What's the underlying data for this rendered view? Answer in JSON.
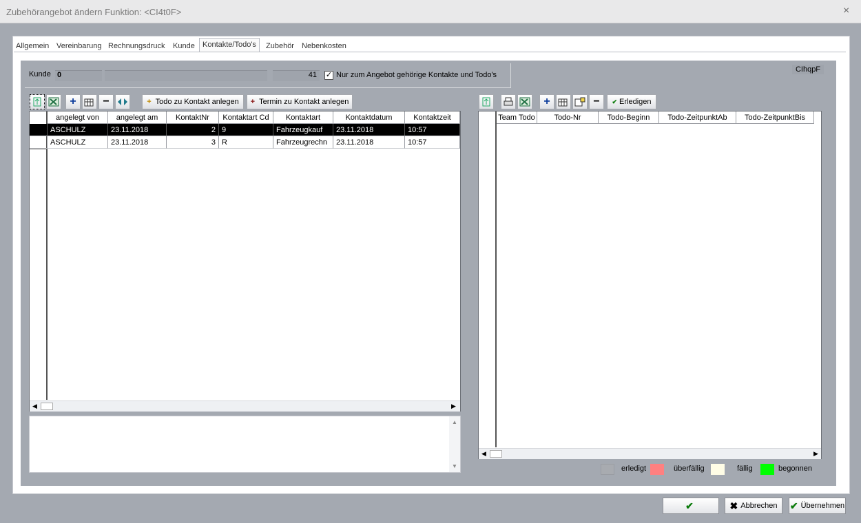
{
  "window": {
    "title": "Zubehörangebot ändern Funktion: <CI4t0F>",
    "close_glyph": "×"
  },
  "tabs": [
    {
      "label": "Allgemein"
    },
    {
      "label": "Vereinbarung"
    },
    {
      "label": "Rechnungsdruck"
    },
    {
      "label": "Kunde"
    },
    {
      "label": "Kontakte/Todo's",
      "active": true
    },
    {
      "label": "Zubehör"
    },
    {
      "label": "Nebenkosten"
    }
  ],
  "kunde": {
    "label": "Kunde",
    "number": "0",
    "count": "41",
    "checkbox_label": "Nur zum Angebot gehörige Kontakte und Todo's",
    "checked": true,
    "code": "CIhqpF"
  },
  "left_toolbar": {
    "todo_button": "Todo zu Kontakt anlegen",
    "termin_button": "Termin zu Kontakt anlegen"
  },
  "contacts": {
    "columns": [
      "angelegt von",
      "angelegt am",
      "KontaktNr",
      "Kontaktart Cd",
      "Kontaktart",
      "Kontaktdatum",
      "Kontaktzeit"
    ],
    "rows": [
      {
        "angelegt_von": "ASCHULZ",
        "angelegt_am": "23.11.2018",
        "kontaktnr": "2",
        "kontaktart_cd": "9",
        "kontaktart": "Fahrzeugkauf",
        "kontaktdatum": "23.11.2018",
        "kontaktzeit": "10:57",
        "selected": true
      },
      {
        "angelegt_von": "ASCHULZ",
        "angelegt_am": "23.11.2018",
        "kontaktnr": "3",
        "kontaktart_cd": "R",
        "kontaktart": "Fahrzeugrechn",
        "kontaktdatum": "23.11.2018",
        "kontaktzeit": "10:57",
        "selected": false
      }
    ]
  },
  "right_toolbar": {
    "erledigen_button": "Erledigen"
  },
  "todos": {
    "columns": [
      "Team Todo",
      "Todo-Nr",
      "Todo-Beginn",
      "Todo-ZeitpunktAb",
      "Todo-ZeitpunktBis"
    ]
  },
  "legend": [
    {
      "label": "erledigt",
      "color": "#a8abb0"
    },
    {
      "label": "überfällig",
      "color": "#ff8080"
    },
    {
      "label": "fällig",
      "color": "#fffde6"
    },
    {
      "label": "begonnen",
      "color": "#00ff00"
    }
  ],
  "bottom_buttons": {
    "ok": "",
    "abbrechen": "Abbrechen",
    "uebernehmen": "Übernehmen"
  },
  "colors": {
    "panel_bg": "#a4a9b1",
    "selection": "#000000"
  }
}
